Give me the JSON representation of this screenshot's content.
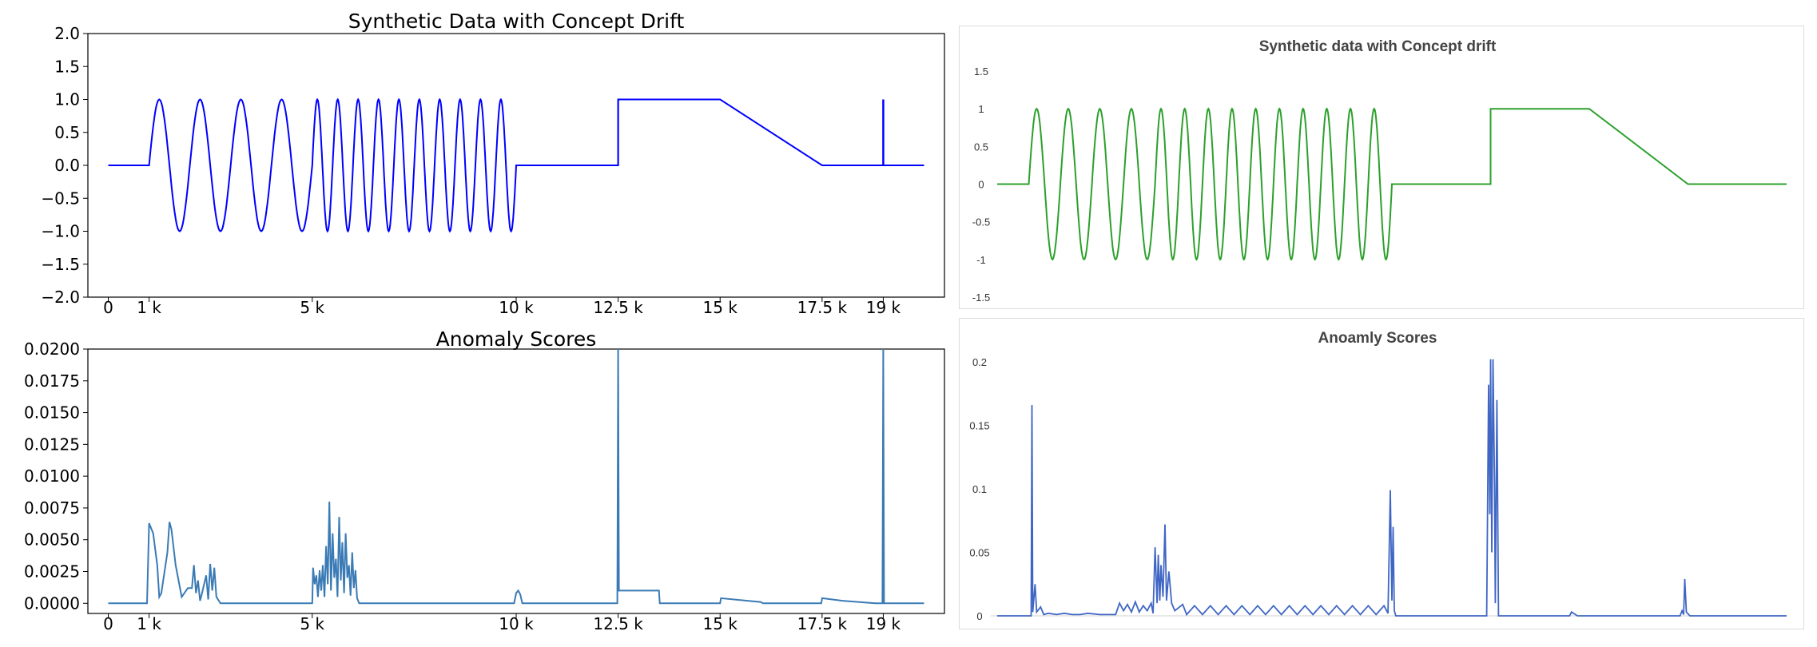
{
  "left_top": {
    "title": "Synthetic Data with Concept Drift",
    "yticks": [
      "2.0",
      "1.5",
      "1.0",
      "0.5",
      "0.0",
      "−0.5",
      "−1.0",
      "−1.5",
      "−2.0"
    ],
    "xticks": [
      "0",
      "1 k",
      "5 k",
      "10 k",
      "12.5 k",
      "15 k",
      "17.5 k",
      "19 k"
    ],
    "color": "#0000ff"
  },
  "left_bottom": {
    "title": "Anomaly Scores",
    "yticks": [
      "0.0200",
      "0.0175",
      "0.0150",
      "0.0125",
      "0.0100",
      "0.0075",
      "0.0050",
      "0.0025",
      "0.0000"
    ],
    "xticks": [
      "0",
      "1 k",
      "5 k",
      "10 k",
      "12.5 k",
      "15 k",
      "17.5 k",
      "19 k"
    ],
    "color": "#3a7ab5"
  },
  "right_top": {
    "title": "Synthetic data with Concept drift",
    "yticks": [
      "1.5",
      "1",
      "0.5",
      "0",
      "-0.5",
      "-1",
      "-1.5"
    ],
    "color": "#2ca02c"
  },
  "right_bottom": {
    "title": "Anoamly Scores",
    "yticks": [
      "0.2",
      "0.15",
      "0.1",
      "0.05",
      "0"
    ],
    "color": "#3f66c4"
  },
  "chart_data": [
    {
      "type": "line",
      "title": "Synthetic Data with Concept Drift",
      "xlim": [
        -500,
        20500
      ],
      "ylim": [
        -2.0,
        2.0
      ],
      "grid": false,
      "series": [
        {
          "segments": [
            {
              "kind": "flat",
              "x": [
                0,
                1000
              ],
              "y": 0
            },
            {
              "kind": "sine",
              "x": [
                1000,
                5000
              ],
              "cycles": 4,
              "amplitude": 1
            },
            {
              "kind": "sine",
              "x": [
                5000,
                10000
              ],
              "cycles": 10,
              "amplitude": 1
            },
            {
              "kind": "flat",
              "x": [
                10000,
                12500
              ],
              "y": 0
            },
            {
              "kind": "flat",
              "x": [
                12500,
                15000
              ],
              "y": 1
            },
            {
              "kind": "ramp",
              "x": [
                15000,
                17500
              ],
              "y": [
                1,
                0
              ]
            },
            {
              "kind": "flat",
              "x": [
                17500,
                20000
              ],
              "y": 0
            },
            {
              "kind": "spike",
              "x": 19000,
              "y": 1
            }
          ]
        }
      ]
    },
    {
      "type": "line",
      "title": "Anomaly Scores",
      "xlim": [
        -500,
        20500
      ],
      "ylim": [
        -0.0008,
        0.02
      ],
      "grid": false,
      "series": [
        {
          "points": [
            [
              0,
              0
            ],
            [
              950,
              0
            ],
            [
              1000,
              0.0063
            ],
            [
              1100,
              0.0055
            ],
            [
              1200,
              0.003
            ],
            [
              1250,
              0.0005
            ],
            [
              1300,
              0.0008
            ],
            [
              1450,
              0.004
            ],
            [
              1500,
              0.0064
            ],
            [
              1550,
              0.0058
            ],
            [
              1650,
              0.003
            ],
            [
              1800,
              0.0005
            ],
            [
              1950,
              0.0012
            ],
            [
              2050,
              0.0012
            ],
            [
              2100,
              0.003
            ],
            [
              2150,
              0.0008
            ],
            [
              2200,
              0.0018
            ],
            [
              2250,
              0.0002
            ],
            [
              2300,
              0.0008
            ],
            [
              2400,
              0.0022
            ],
            [
              2450,
              0.0003
            ],
            [
              2500,
              0.0031
            ],
            [
              2550,
              0.001
            ],
            [
              2600,
              0.0028
            ],
            [
              2650,
              0.0005
            ],
            [
              2750,
              0
            ],
            [
              5000,
              0
            ],
            [
              5020,
              0.0028
            ],
            [
              5060,
              0.0015
            ],
            [
              5100,
              0.0022
            ],
            [
              5140,
              0.0005
            ],
            [
              5180,
              0.0026
            ],
            [
              5220,
              0.001
            ],
            [
              5260,
              0.003
            ],
            [
              5300,
              0.0005
            ],
            [
              5340,
              0.0045
            ],
            [
              5380,
              0.0015
            ],
            [
              5420,
              0.008
            ],
            [
              5460,
              0.001
            ],
            [
              5500,
              0.0055
            ],
            [
              5540,
              0.002
            ],
            [
              5580,
              0.0035
            ],
            [
              5620,
              0.0005
            ],
            [
              5660,
              0.0068
            ],
            [
              5700,
              0.0018
            ],
            [
              5740,
              0.0048
            ],
            [
              5780,
              0.0008
            ],
            [
              5820,
              0.0055
            ],
            [
              5860,
              0.002
            ],
            [
              5900,
              0.003
            ],
            [
              5940,
              0.0006
            ],
            [
              5980,
              0.004
            ],
            [
              6020,
              0.0012
            ],
            [
              6060,
              0.0026
            ],
            [
              6100,
              0.0004
            ],
            [
              6150,
              0
            ],
            [
              9950,
              0
            ],
            [
              10000,
              0.0008
            ],
            [
              10050,
              0.001
            ],
            [
              10100,
              0.0007
            ],
            [
              10150,
              0
            ],
            [
              12480,
              0
            ],
            [
              12500,
              0.02
            ],
            [
              12520,
              0.001
            ],
            [
              13500,
              0.001
            ],
            [
              13520,
              0
            ],
            [
              15000,
              0
            ],
            [
              15020,
              0.0004
            ],
            [
              16000,
              0.0001
            ],
            [
              16050,
              0
            ],
            [
              17480,
              0
            ],
            [
              17500,
              0.0004
            ],
            [
              18000,
              0.0002
            ],
            [
              18800,
              0
            ],
            [
              18980,
              0
            ],
            [
              19000,
              0.02
            ],
            [
              19020,
              0
            ],
            [
              20000,
              0
            ]
          ]
        }
      ]
    },
    {
      "type": "line",
      "title": "Synthetic data with Concept drift",
      "xlim": [
        0,
        20000
      ],
      "ylim": [
        -1.5,
        1.5
      ],
      "grid": false,
      "series": [
        {
          "segments": [
            {
              "kind": "flat",
              "x": [
                0,
                800
              ],
              "y": 0
            },
            {
              "kind": "sine",
              "x": [
                800,
                4000
              ],
              "cycles": 4,
              "amplitude": 1
            },
            {
              "kind": "sine",
              "x": [
                4000,
                10000
              ],
              "cycles": 10,
              "amplitude": 1
            },
            {
              "kind": "flat",
              "x": [
                10000,
                12500
              ],
              "y": 0
            },
            {
              "kind": "flat",
              "x": [
                12500,
                15000
              ],
              "y": 1
            },
            {
              "kind": "ramp",
              "x": [
                15000,
                17500
              ],
              "y": [
                1,
                0
              ]
            },
            {
              "kind": "flat",
              "x": [
                17500,
                20000
              ],
              "y": 0
            }
          ]
        }
      ]
    },
    {
      "type": "line",
      "title": "Anoamly Scores",
      "xlim": [
        0,
        20000
      ],
      "ylim": [
        0,
        0.21
      ],
      "grid": false,
      "series": [
        {
          "points": [
            [
              0,
              0
            ],
            [
              860,
              0
            ],
            [
              880,
              0.166
            ],
            [
              900,
              0.003
            ],
            [
              960,
              0.025
            ],
            [
              1000,
              0.003
            ],
            [
              1100,
              0.007
            ],
            [
              1180,
              0.001
            ],
            [
              1300,
              0.002
            ],
            [
              1500,
              0.001
            ],
            [
              1700,
              0.002
            ],
            [
              1900,
              0.001
            ],
            [
              2100,
              0.001
            ],
            [
              2300,
              0.002
            ],
            [
              2600,
              0.001
            ],
            [
              3000,
              0.001
            ],
            [
              3100,
              0.01
            ],
            [
              3200,
              0.004
            ],
            [
              3300,
              0.009
            ],
            [
              3400,
              0.003
            ],
            [
              3500,
              0.011
            ],
            [
              3600,
              0.003
            ],
            [
              3700,
              0.008
            ],
            [
              3800,
              0.004
            ],
            [
              3900,
              0.01
            ],
            [
              3950,
              0.002
            ],
            [
              4000,
              0.054
            ],
            [
              4050,
              0.01
            ],
            [
              4080,
              0.048
            ],
            [
              4120,
              0.012
            ],
            [
              4150,
              0.04
            ],
            [
              4200,
              0.015
            ],
            [
              4250,
              0.072
            ],
            [
              4290,
              0.012
            ],
            [
              4350,
              0.035
            ],
            [
              4420,
              0.01
            ],
            [
              4500,
              0.004
            ],
            [
              4700,
              0.009
            ],
            [
              4800,
              0.001
            ],
            [
              5000,
              0.008
            ],
            [
              5200,
              0.001
            ],
            [
              5400,
              0.008
            ],
            [
              5600,
              0.001
            ],
            [
              5800,
              0.008
            ],
            [
              6000,
              0.001
            ],
            [
              6200,
              0.008
            ],
            [
              6400,
              0.001
            ],
            [
              6600,
              0.008
            ],
            [
              6800,
              0.001
            ],
            [
              7000,
              0.008
            ],
            [
              7200,
              0.001
            ],
            [
              7400,
              0.008
            ],
            [
              7600,
              0.001
            ],
            [
              7800,
              0.008
            ],
            [
              8000,
              0.001
            ],
            [
              8200,
              0.008
            ],
            [
              8400,
              0.001
            ],
            [
              8600,
              0.008
            ],
            [
              8800,
              0.001
            ],
            [
              9000,
              0.008
            ],
            [
              9200,
              0.001
            ],
            [
              9400,
              0.008
            ],
            [
              9600,
              0.001
            ],
            [
              9800,
              0.008
            ],
            [
              9900,
              0.002
            ],
            [
              9960,
              0.099
            ],
            [
              10000,
              0.012
            ],
            [
              10030,
              0.07
            ],
            [
              10060,
              0.004
            ],
            [
              10100,
              0
            ],
            [
              12400,
              0
            ],
            [
              12450,
              0.182
            ],
            [
              12480,
              0.08
            ],
            [
              12500,
              0.202
            ],
            [
              12530,
              0.05
            ],
            [
              12560,
              0.202
            ],
            [
              12600,
              0.104
            ],
            [
              12620,
              0.01
            ],
            [
              12660,
              0.17
            ],
            [
              12700,
              0
            ],
            [
              14500,
              0
            ],
            [
              14550,
              0.003
            ],
            [
              14650,
              0.001
            ],
            [
              14700,
              0
            ],
            [
              17300,
              0
            ],
            [
              17350,
              0.004
            ],
            [
              17390,
              0.001
            ],
            [
              17420,
              0.029
            ],
            [
              17460,
              0.003
            ],
            [
              17550,
              0
            ],
            [
              20000,
              0
            ]
          ]
        }
      ]
    }
  ]
}
